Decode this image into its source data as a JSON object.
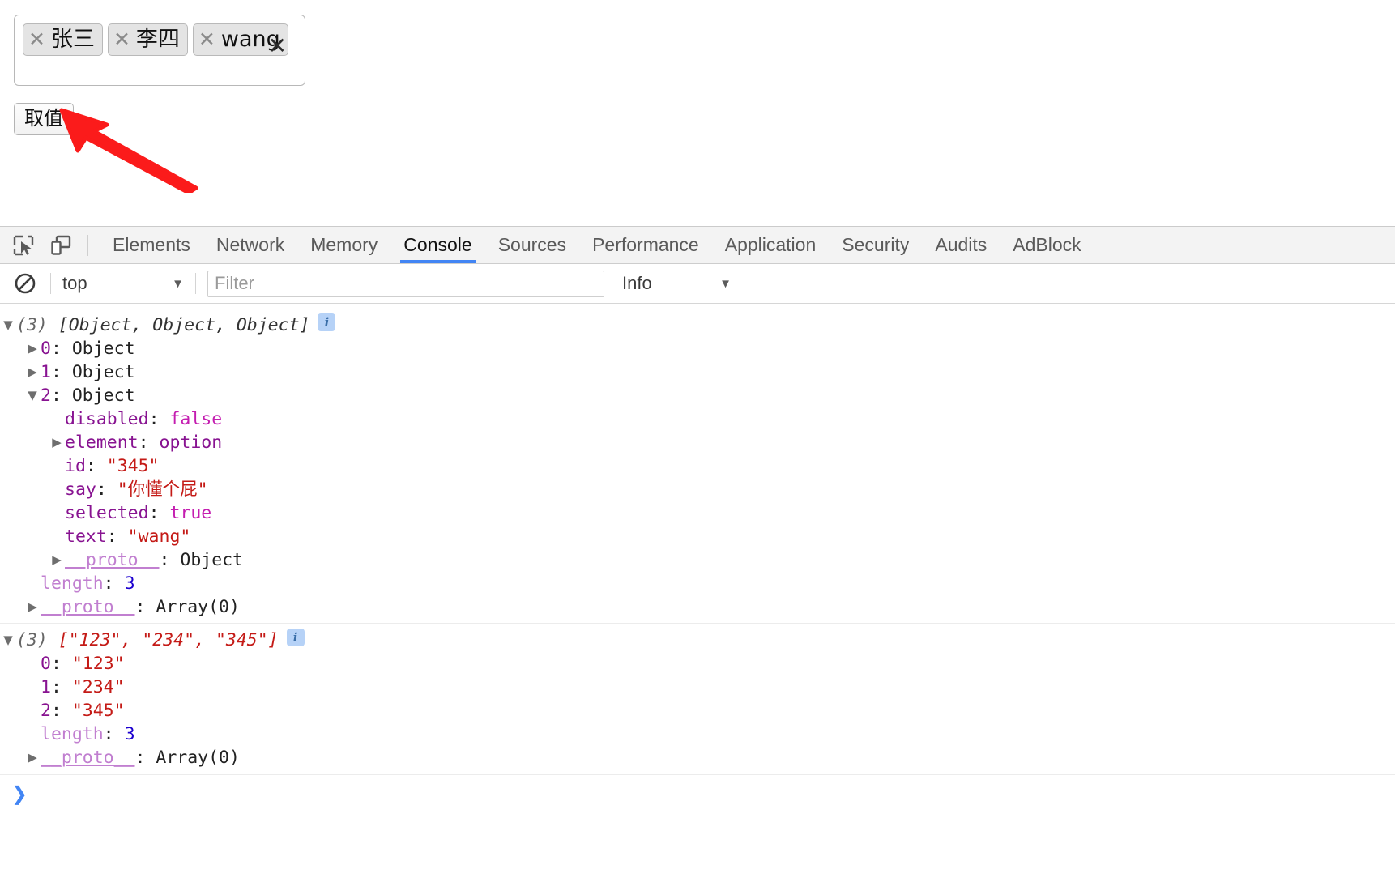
{
  "page": {
    "tag_select": {
      "chips": [
        {
          "remove_icon": "close-icon",
          "label": "张三"
        },
        {
          "remove_icon": "close-icon",
          "label": "李四"
        },
        {
          "remove_icon": "close-icon",
          "label": "wang"
        }
      ],
      "clear_all_icon": "close-icon",
      "clear_all_label": "✕"
    },
    "take_value_button": "取值",
    "annotation": {
      "type": "red-arrow",
      "color": "#fb1b1b",
      "points_to": "take-value-button"
    }
  },
  "devtools": {
    "toolbar": {
      "inspect_icon": "inspect-element-icon",
      "device_icon": "device-toolbar-icon",
      "tabs": [
        {
          "label": "Elements",
          "active": false
        },
        {
          "label": "Network",
          "active": false
        },
        {
          "label": "Memory",
          "active": false
        },
        {
          "label": "Console",
          "active": true
        },
        {
          "label": "Sources",
          "active": false
        },
        {
          "label": "Performance",
          "active": false
        },
        {
          "label": "Application",
          "active": false
        },
        {
          "label": "Security",
          "active": false
        },
        {
          "label": "Audits",
          "active": false
        },
        {
          "label": "AdBlock",
          "active": false
        }
      ],
      "active_tab_color": "#4285f4"
    },
    "filterbar": {
      "clear_icon": "clear-console-icon",
      "context": "top",
      "context_caret": "▼",
      "filter_placeholder": "Filter",
      "filter_value": "",
      "level": "Info",
      "level_caret": "▼"
    },
    "console": {
      "groups": [
        {
          "header": {
            "toggle": "▼",
            "count": "(3)",
            "preview": "[Object, Object, Object]",
            "badge": "i"
          },
          "rows": [
            {
              "indent": 1,
              "toggle": "▶",
              "key": "0",
              "key_kind": "index",
              "sep": ": ",
              "value": "Object",
              "value_kind": "object"
            },
            {
              "indent": 1,
              "toggle": "▶",
              "key": "1",
              "key_kind": "index",
              "sep": ": ",
              "value": "Object",
              "value_kind": "object"
            },
            {
              "indent": 1,
              "toggle": "▼",
              "key": "2",
              "key_kind": "index",
              "sep": ": ",
              "value": "Object",
              "value_kind": "object"
            },
            {
              "indent": 2,
              "toggle": "",
              "key": "disabled",
              "key_kind": "prop",
              "sep": ": ",
              "value": "false",
              "value_kind": "bool"
            },
            {
              "indent": 2,
              "toggle": "▶",
              "key": "element",
              "key_kind": "prop",
              "sep": ": ",
              "value": "option",
              "value_kind": "prop"
            },
            {
              "indent": 2,
              "toggle": "",
              "key": "id",
              "key_kind": "prop",
              "sep": ": ",
              "value": "\"345\"",
              "value_kind": "string"
            },
            {
              "indent": 2,
              "toggle": "",
              "key": "say",
              "key_kind": "prop",
              "sep": ": ",
              "value": "\"你懂个屁\"",
              "value_kind": "string"
            },
            {
              "indent": 2,
              "toggle": "",
              "key": "selected",
              "key_kind": "prop",
              "sep": ": ",
              "value": "true",
              "value_kind": "bool"
            },
            {
              "indent": 2,
              "toggle": "",
              "key": "text",
              "key_kind": "prop",
              "sep": ": ",
              "value": "\"wang\"",
              "value_kind": "string"
            },
            {
              "indent": 2,
              "toggle": "▶",
              "key": "__proto__",
              "key_kind": "proto",
              "sep": ": ",
              "value": "Object",
              "value_kind": "object"
            },
            {
              "indent": 1,
              "toggle": "",
              "key": "length",
              "key_kind": "dim",
              "sep": ": ",
              "value": "3",
              "value_kind": "number"
            },
            {
              "indent": 1,
              "toggle": "▶",
              "key": "__proto__",
              "key_kind": "proto",
              "sep": ": ",
              "value": "Array(0)",
              "value_kind": "object"
            }
          ]
        },
        {
          "header": {
            "toggle": "▼",
            "count": "(3)",
            "preview": "[\"123\", \"234\", \"345\"]",
            "badge": "i"
          },
          "rows": [
            {
              "indent": 1,
              "toggle": "",
              "key": "0",
              "key_kind": "index",
              "sep": ": ",
              "value": "\"123\"",
              "value_kind": "string"
            },
            {
              "indent": 1,
              "toggle": "",
              "key": "1",
              "key_kind": "index",
              "sep": ": ",
              "value": "\"234\"",
              "value_kind": "string"
            },
            {
              "indent": 1,
              "toggle": "",
              "key": "2",
              "key_kind": "index",
              "sep": ": ",
              "value": "\"345\"",
              "value_kind": "string"
            },
            {
              "indent": 1,
              "toggle": "",
              "key": "length",
              "key_kind": "dim",
              "sep": ": ",
              "value": "3",
              "value_kind": "number"
            },
            {
              "indent": 1,
              "toggle": "▶",
              "key": "__proto__",
              "key_kind": "proto",
              "sep": ": ",
              "value": "Array(0)",
              "value_kind": "object"
            }
          ]
        }
      ],
      "prompt_chevron": "❯",
      "prompt_value": ""
    }
  },
  "colors": {
    "accent": "#4285f4",
    "string": "#c41a16",
    "key": "#881391",
    "number": "#1c00cf",
    "bool": "#c41eb0",
    "proto": "#c17fd0",
    "arrow": "#fb1b1b"
  }
}
